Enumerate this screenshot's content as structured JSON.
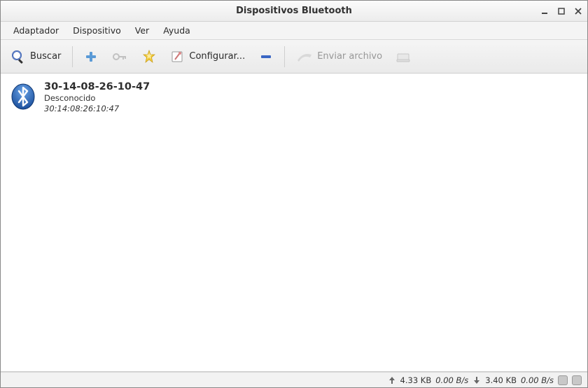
{
  "title": "Dispositivos Bluetooth",
  "menubar": {
    "adapter": "Adaptador",
    "device": "Dispositivo",
    "view": "Ver",
    "help": "Ayuda"
  },
  "toolbar": {
    "search": "Buscar",
    "configure": "Configurar...",
    "send_file": "Enviar archivo"
  },
  "devices": [
    {
      "name": "30-14-08-26-10-47",
      "type": "Desconocido",
      "mac": "30:14:08:26:10:47"
    }
  ],
  "statusbar": {
    "up_total": "4.33 KB",
    "up_rate": "0.00 B/s",
    "down_total": "3.40 KB",
    "down_rate": "0.00 B/s"
  }
}
